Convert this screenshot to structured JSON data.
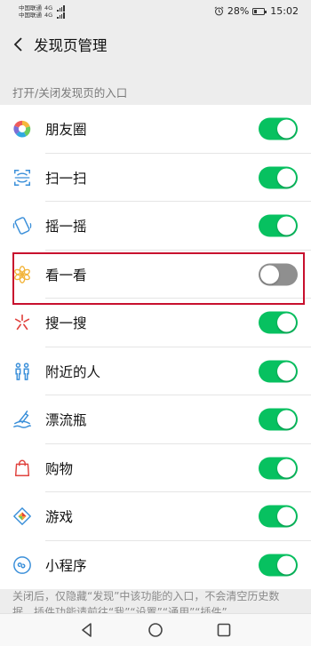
{
  "status_bar": {
    "carrier_1": "中国联通",
    "carrier_2": "中国联通",
    "network_1": "4G",
    "network_2": "4G",
    "battery_percent": "28%",
    "battery_level": 0.28,
    "time": "15:02"
  },
  "nav": {
    "back_icon": "chevron-left-icon",
    "title": "发现页管理"
  },
  "section": {
    "header": "打开/关闭发现页的入口"
  },
  "items": [
    {
      "label": "朋友圈",
      "icon": "moments-icon",
      "enabled": true
    },
    {
      "label": "扫一扫",
      "icon": "scan-icon",
      "enabled": true
    },
    {
      "label": "摇一摇",
      "icon": "shake-icon",
      "enabled": true
    },
    {
      "label": "看一看",
      "icon": "top-stories-icon",
      "enabled": false
    },
    {
      "label": "搜一搜",
      "icon": "search-icon",
      "enabled": true
    },
    {
      "label": "附近的人",
      "icon": "people-nearby-icon",
      "enabled": true
    },
    {
      "label": "漂流瓶",
      "icon": "drift-bottle-icon",
      "enabled": true
    },
    {
      "label": "购物",
      "icon": "shopping-bag-icon",
      "enabled": true
    },
    {
      "label": "游戏",
      "icon": "games-icon",
      "enabled": true
    },
    {
      "label": "小程序",
      "icon": "mini-programs-icon",
      "enabled": true
    }
  ],
  "footer": {
    "note": "关闭后，仅隐藏“发现”中该功能的入口，不会清空历史数据，插件功能请前往“我”“设置”“通用”“插件”"
  },
  "colors": {
    "toggle_on": "#07c160",
    "toggle_off": "#8f8f8f",
    "highlight": "#c8102e",
    "background": "#ededed"
  },
  "system_nav": {
    "back": "triangle-back-icon",
    "home": "circle-home-icon",
    "recents": "square-recents-icon"
  }
}
